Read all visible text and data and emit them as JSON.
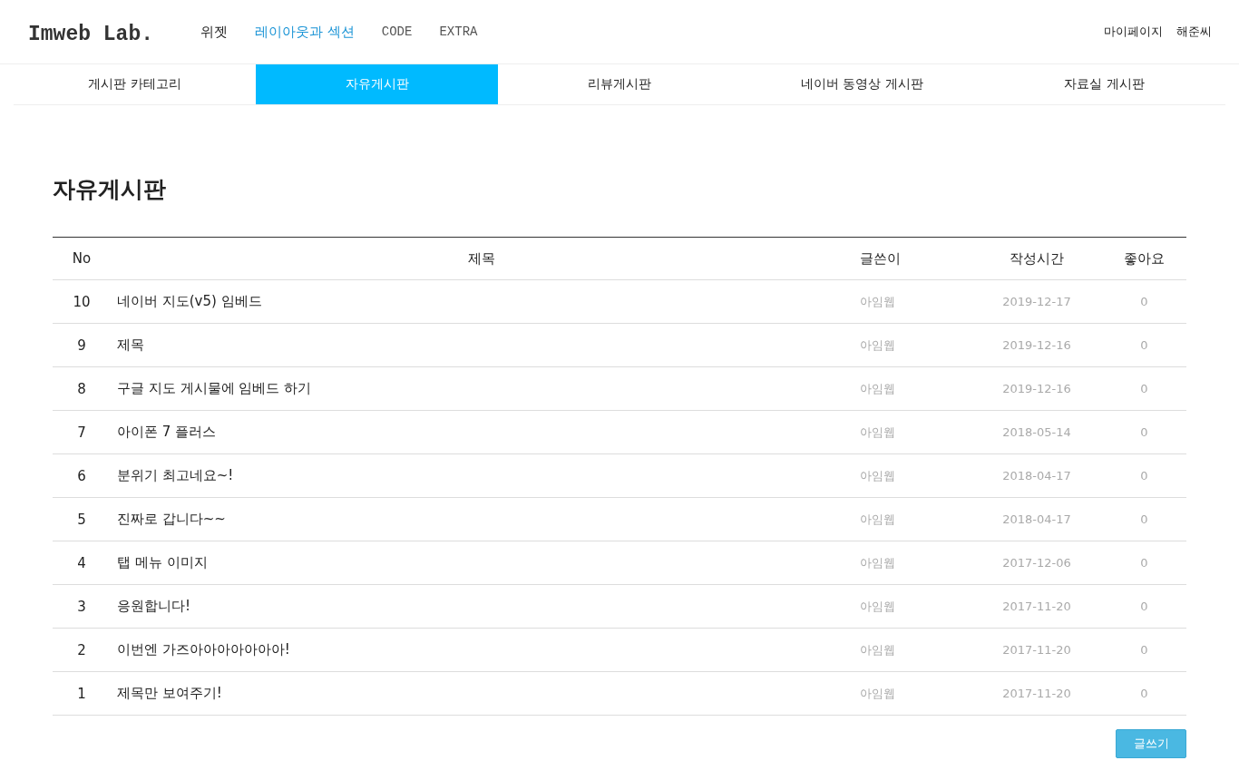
{
  "logo": "Imweb Lab.",
  "nav": [
    {
      "label": "위젯",
      "kind": "sans",
      "selected": false
    },
    {
      "label": "레이아웃과 섹션",
      "kind": "sans",
      "selected": true
    },
    {
      "label": "CODE",
      "kind": "mono",
      "selected": false
    },
    {
      "label": "EXTRA",
      "kind": "mono",
      "selected": false
    }
  ],
  "user_links": [
    "마이페이지",
    "해준씨"
  ],
  "tabs": [
    {
      "label": "게시판 카테고리",
      "selected": false
    },
    {
      "label": "자유게시판",
      "selected": true
    },
    {
      "label": "리뷰게시판",
      "selected": false
    },
    {
      "label": "네이버 동영상 게시판",
      "selected": false
    },
    {
      "label": "자료실 게시판",
      "selected": false
    }
  ],
  "page_title": "자유게시판",
  "table": {
    "columns": [
      "No",
      "제목",
      "글쓴이",
      "작성시간",
      "좋아요"
    ],
    "rows": [
      [
        "10",
        "네이버 지도(v5) 임베드",
        "아임웹",
        "2019-12-17",
        "0"
      ],
      [
        "9",
        "제목",
        "아임웹",
        "2019-12-16",
        "0"
      ],
      [
        "8",
        "구글 지도 게시물에 임베드 하기",
        "아임웹",
        "2019-12-16",
        "0"
      ],
      [
        "7",
        "아이폰 7 플러스",
        "아임웹",
        "2018-05-14",
        "0"
      ],
      [
        "6",
        "분위기 최고네요~!",
        "아임웹",
        "2018-04-17",
        "0"
      ],
      [
        "5",
        "진짜로 갑니다~~",
        "아임웹",
        "2018-04-17",
        "0"
      ],
      [
        "4",
        "탭 메뉴 이미지",
        "아임웹",
        "2017-12-06",
        "0"
      ],
      [
        "3",
        "응원합니다!",
        "아임웹",
        "2017-11-20",
        "0"
      ],
      [
        "2",
        "이번엔 가즈아아아아아아아!",
        "아임웹",
        "2017-11-20",
        "0"
      ],
      [
        "1",
        "제목만 보여주기!",
        "아임웹",
        "2017-11-20",
        "0"
      ]
    ]
  },
  "write_button": "글쓰기"
}
